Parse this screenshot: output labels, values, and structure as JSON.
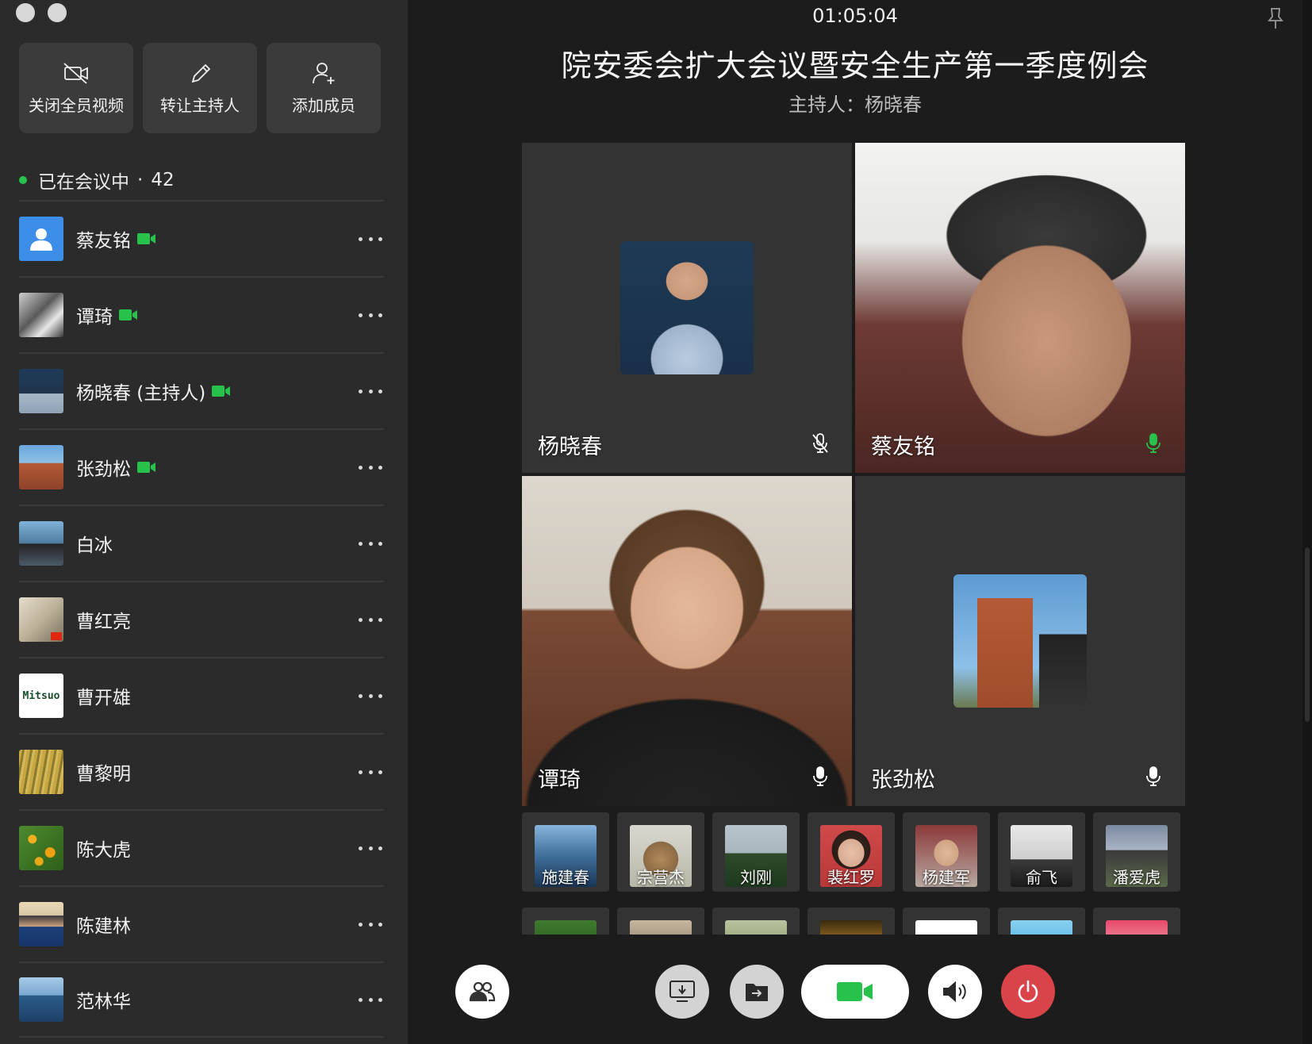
{
  "window": {
    "controls": [
      "close",
      "minimize"
    ]
  },
  "actions": [
    {
      "label": "关闭全员视频",
      "icon": "video-off-icon"
    },
    {
      "label": "转让主持人",
      "icon": "pencil-icon"
    },
    {
      "label": "添加成员",
      "icon": "add-person-icon"
    }
  ],
  "meeting_status": {
    "label": "已在会议中",
    "separator": "·",
    "count": "42",
    "status_color": "#27c24c"
  },
  "members": [
    {
      "name": "蔡友铭",
      "video_on": true,
      "avatar": "default-avatar"
    },
    {
      "name": "谭琦",
      "video_on": true,
      "avatar": "dog-photo"
    },
    {
      "name": "杨晓春 (主持人)",
      "video_on": true,
      "avatar": "man-portrait"
    },
    {
      "name": "张劲松",
      "video_on": true,
      "avatar": "building-photo"
    },
    {
      "name": "白冰",
      "video_on": false,
      "avatar": "photographer-photo"
    },
    {
      "name": "曹红亮",
      "video_on": false,
      "avatar": "calligraphy-photo"
    },
    {
      "name": "曹开雄",
      "video_on": false,
      "avatar": "mitsuo-logo",
      "avatar_text": "Mitsuo"
    },
    {
      "name": "曹黎明",
      "video_on": false,
      "avatar": "rice-field-photo"
    },
    {
      "name": "陈大虎",
      "video_on": false,
      "avatar": "fruit-tree-photo"
    },
    {
      "name": "陈建林",
      "video_on": false,
      "avatar": "man-hat-photo"
    },
    {
      "name": "范林华",
      "video_on": false,
      "avatar": "sea-photo"
    }
  ],
  "main": {
    "timer": "01:05:04",
    "title": "院安委会扩大会议暨安全生产第一季度例会",
    "host_line": "主持人：杨晓春",
    "tiles": [
      {
        "name": "杨晓春",
        "mic": "muted",
        "content": "avatar-picture"
      },
      {
        "name": "蔡友铭",
        "mic": "active",
        "content": "live-video"
      },
      {
        "name": "谭琦",
        "mic": "on",
        "content": "live-video"
      },
      {
        "name": "张劲松",
        "mic": "on",
        "content": "avatar-picture"
      }
    ],
    "strip": [
      "施建春",
      "宗营杰",
      "刘刚",
      "裴红罗",
      "杨建军",
      "俞飞",
      "潘爱虎"
    ]
  },
  "controls": [
    "members-icon",
    "screen-share-icon",
    "file-share-icon",
    "video-camera-icon",
    "speaker-icon",
    "power-icon"
  ],
  "colors": {
    "accent_green": "#27c24c",
    "hangup_red": "#d8444a",
    "sidebar_bg": "#2b2b2b",
    "tile_bg": "#333333"
  }
}
